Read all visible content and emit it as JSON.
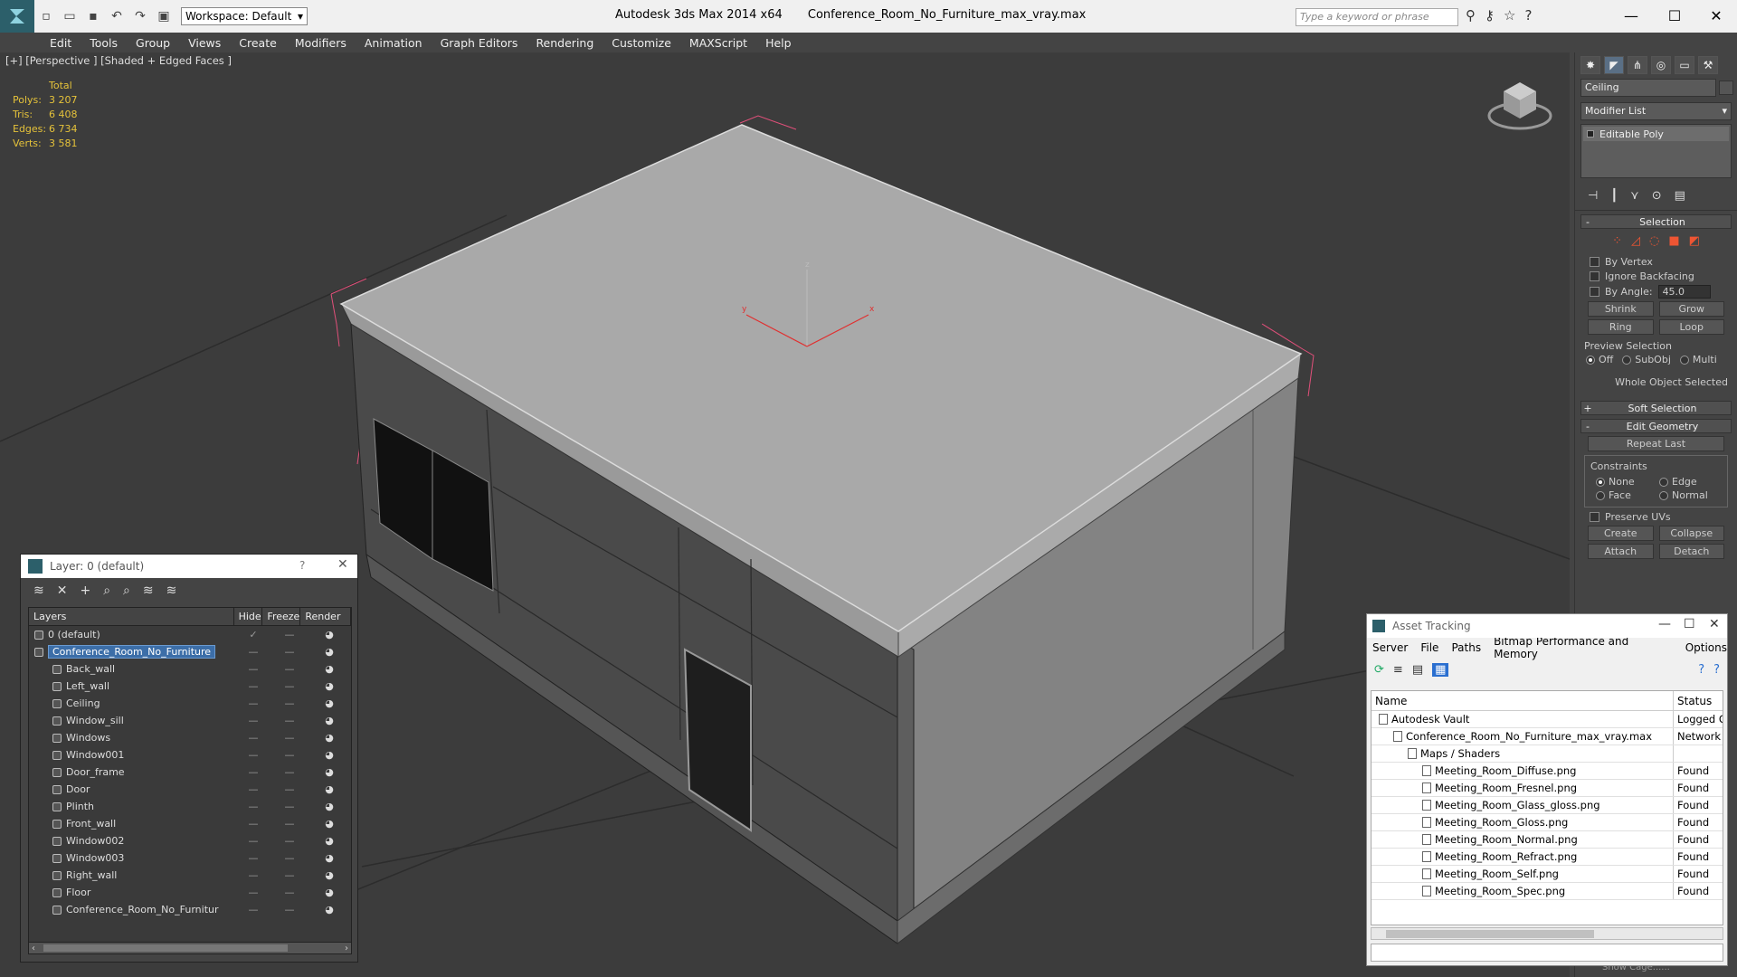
{
  "titlebar": {
    "workspace": "Workspace: Default",
    "app_name": "Autodesk 3ds Max  2014 x64",
    "file_name": "Conference_Room_No_Furniture_max_vray.max",
    "search_placeholder": "Type a keyword or phrase"
  },
  "menu": [
    "Edit",
    "Tools",
    "Group",
    "Views",
    "Create",
    "Modifiers",
    "Animation",
    "Graph Editors",
    "Rendering",
    "Customize",
    "MAXScript",
    "Help"
  ],
  "viewport": {
    "label": "[+] [Perspective ] [Shaded + Edged Faces ]",
    "stats_header": "Total",
    "stats": [
      {
        "k": "Polys:",
        "v": "3 207"
      },
      {
        "k": "Tris:",
        "v": "6 408"
      },
      {
        "k": "Edges:",
        "v": "6 734"
      },
      {
        "k": "Verts:",
        "v": "3 581"
      }
    ],
    "axis": {
      "x": "x",
      "y": "y",
      "z": "z"
    }
  },
  "command_panel": {
    "object_name": "Ceiling",
    "modifier_list": "Modifier List",
    "stack_item": "Editable Poly",
    "selection": {
      "title": "Selection",
      "by_vertex": "By Vertex",
      "ignore_backfacing": "Ignore Backfacing",
      "by_angle": "By Angle:",
      "angle_value": "45.0",
      "shrink": "Shrink",
      "grow": "Grow",
      "ring": "Ring",
      "loop": "Loop",
      "preview_title": "Preview Selection",
      "preview_off": "Off",
      "preview_subobj": "SubObj",
      "preview_multi": "Multi",
      "status": "Whole Object Selected"
    },
    "soft_selection": "Soft Selection",
    "edit_geometry": {
      "title": "Edit Geometry",
      "repeat_last": "Repeat Last",
      "constraints": "Constraints",
      "none": "None",
      "edge": "Edge",
      "face": "Face",
      "normal": "Normal",
      "preserve_uvs": "Preserve UVs",
      "create": "Create",
      "collapse": "Collapse",
      "attach": "Attach",
      "detach": "Detach"
    },
    "bottom_cut": "Show Cage......"
  },
  "layer_panel": {
    "title": "Layer: 0 (default)",
    "help": "?",
    "columns": {
      "layers": "Layers",
      "hide": "Hide",
      "freeze": "Freeze",
      "render": "Render"
    },
    "rows": [
      {
        "name": "0 (default)",
        "level": 0,
        "selected": false
      },
      {
        "name": "Conference_Room_No_Furniture",
        "level": 0,
        "selected": true
      },
      {
        "name": "Back_wall",
        "level": 1,
        "selected": false
      },
      {
        "name": "Left_wall",
        "level": 1,
        "selected": false
      },
      {
        "name": "Ceiling",
        "level": 1,
        "selected": false
      },
      {
        "name": "Window_sill",
        "level": 1,
        "selected": false
      },
      {
        "name": "Windows",
        "level": 1,
        "selected": false
      },
      {
        "name": "Window001",
        "level": 1,
        "selected": false
      },
      {
        "name": "Door_frame",
        "level": 1,
        "selected": false
      },
      {
        "name": "Door",
        "level": 1,
        "selected": false
      },
      {
        "name": "Plinth",
        "level": 1,
        "selected": false
      },
      {
        "name": "Front_wall",
        "level": 1,
        "selected": false
      },
      {
        "name": "Window002",
        "level": 1,
        "selected": false
      },
      {
        "name": "Window003",
        "level": 1,
        "selected": false
      },
      {
        "name": "Right_wall",
        "level": 1,
        "selected": false
      },
      {
        "name": "Floor",
        "level": 1,
        "selected": false
      },
      {
        "name": "Conference_Room_No_Furnitur",
        "level": 1,
        "selected": false
      }
    ]
  },
  "asset_panel": {
    "title": "Asset Tracking",
    "menu": [
      "Server",
      "File",
      "Paths",
      "Bitmap Performance and Memory",
      "Options"
    ],
    "columns": {
      "name": "Name",
      "status": "Status"
    },
    "rows": [
      {
        "name": "Autodesk Vault",
        "status": "Logged O",
        "level": 0
      },
      {
        "name": "Conference_Room_No_Furniture_max_vray.max",
        "status": "Network I",
        "level": 1
      },
      {
        "name": "Maps / Shaders",
        "status": "",
        "level": 2
      },
      {
        "name": "Meeting_Room_Diffuse.png",
        "status": "Found",
        "level": 3
      },
      {
        "name": "Meeting_Room_Fresnel.png",
        "status": "Found",
        "level": 3
      },
      {
        "name": "Meeting_Room_Glass_gloss.png",
        "status": "Found",
        "level": 3
      },
      {
        "name": "Meeting_Room_Gloss.png",
        "status": "Found",
        "level": 3
      },
      {
        "name": "Meeting_Room_Normal.png",
        "status": "Found",
        "level": 3
      },
      {
        "name": "Meeting_Room_Refract.png",
        "status": "Found",
        "level": 3
      },
      {
        "name": "Meeting_Room_Self.png",
        "status": "Found",
        "level": 3
      },
      {
        "name": "Meeting_Room_Spec.png",
        "status": "Found",
        "level": 3
      }
    ]
  },
  "colors": {
    "selection_blue": "#3c6ea8",
    "stats_yellow": "#e5c23a",
    "bbox_pink": "#e0507a"
  }
}
